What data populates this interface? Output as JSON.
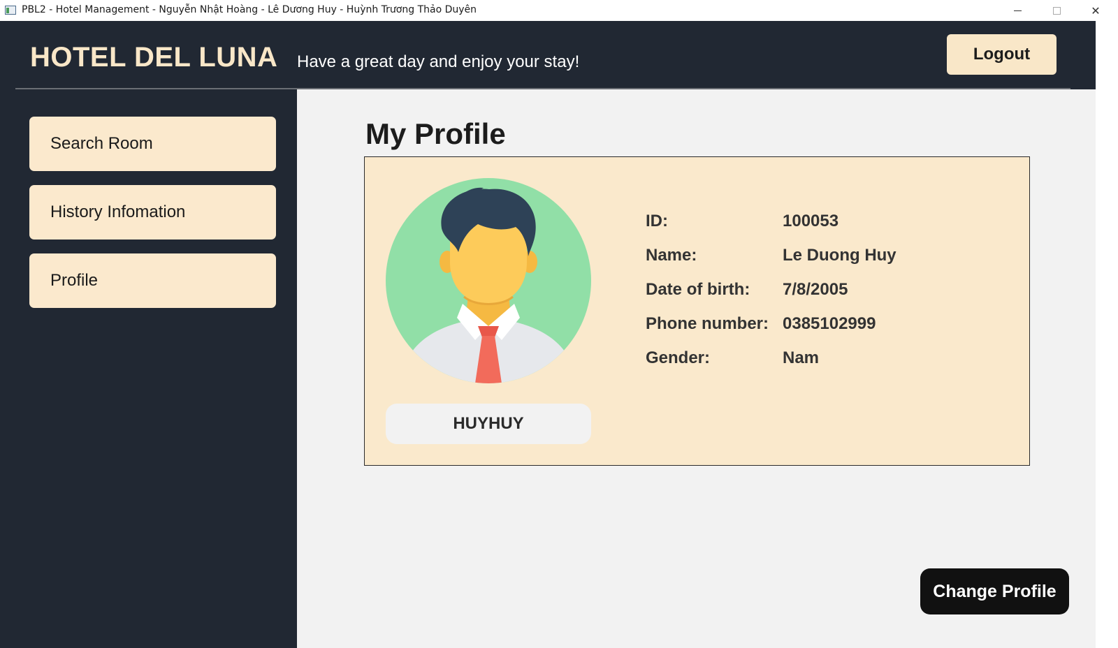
{
  "window": {
    "title": "PBL2 - Hotel Management - Nguyễn Nhật Hoàng - Lê Dương Huy - Huỳnh Trương Thảo Duyên",
    "close_glyph": "✕"
  },
  "header": {
    "brand": "HOTEL DEL LUNA",
    "tagline": "Have a great day and enjoy your stay!",
    "logout_label": "Logout"
  },
  "sidebar": {
    "items": [
      {
        "label": "Search Room"
      },
      {
        "label": "History Infomation"
      },
      {
        "label": "Profile"
      }
    ]
  },
  "main": {
    "page_title": "My Profile",
    "username": "HUYHUY",
    "fields": [
      {
        "label": "ID:",
        "value": "100053"
      },
      {
        "label": "Name:",
        "value": "Le Duong Huy"
      },
      {
        "label": "Date of birth:",
        "value": "7/8/2005"
      },
      {
        "label": "Phone number:",
        "value": "0385102999"
      },
      {
        "label": "Gender:",
        "value": "Nam"
      }
    ],
    "change_profile_label": "Change Profile"
  },
  "colors": {
    "dark_bg": "#212833",
    "cream": "#fbe9cd",
    "card_bg": "#fae9cc",
    "avatar_bg": "#91dfa7"
  },
  "icons": {
    "avatar": "user-avatar-illustration",
    "app": "app-window-icon"
  }
}
